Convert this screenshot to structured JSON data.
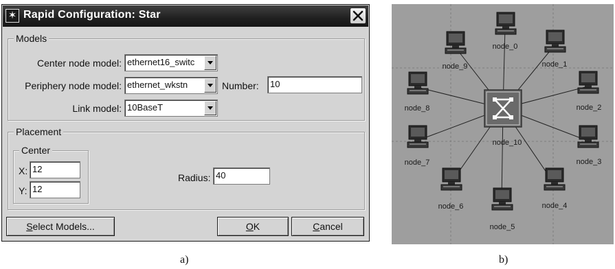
{
  "dialog": {
    "title": "Rapid Configuration: Star",
    "models": {
      "legend": "Models",
      "center_label": "Center node model:",
      "center_value": "ethernet16_switc",
      "periphery_label": "Periphery node model:",
      "periphery_value": "ethernet_wkstn",
      "number_label": "Number:",
      "number_value": "10",
      "link_label": "Link model:",
      "link_value": "10BaseT"
    },
    "placement": {
      "legend": "Placement",
      "center_legend": "Center",
      "x_label": "X:",
      "x_value": "12",
      "y_label": "Y:",
      "y_value": "12",
      "radius_label": "Radius:",
      "radius_value": "40"
    },
    "buttons": {
      "select_models_underlined": "S",
      "select_models_rest": "elect Models...",
      "ok_underlined": "O",
      "ok_rest": "K",
      "cancel_underlined": "C",
      "cancel_rest": "ancel"
    }
  },
  "captions": {
    "a": "a)",
    "b": "b)"
  },
  "network": {
    "hub": "node_10",
    "nodes": [
      "node_0",
      "node_1",
      "node_2",
      "node_3",
      "node_4",
      "node_5",
      "node_6",
      "node_7",
      "node_8",
      "node_9"
    ]
  },
  "icons": {
    "window_icon": "star-window-icon",
    "close": "close-icon",
    "hub": "switch-icon",
    "node": "workstation-icon"
  },
  "colors": {
    "titlebar": "#202020",
    "dialog_bg": "#d4d4d4",
    "panel_bg": "#9e9e9e",
    "hub": "#6e6e6e"
  }
}
